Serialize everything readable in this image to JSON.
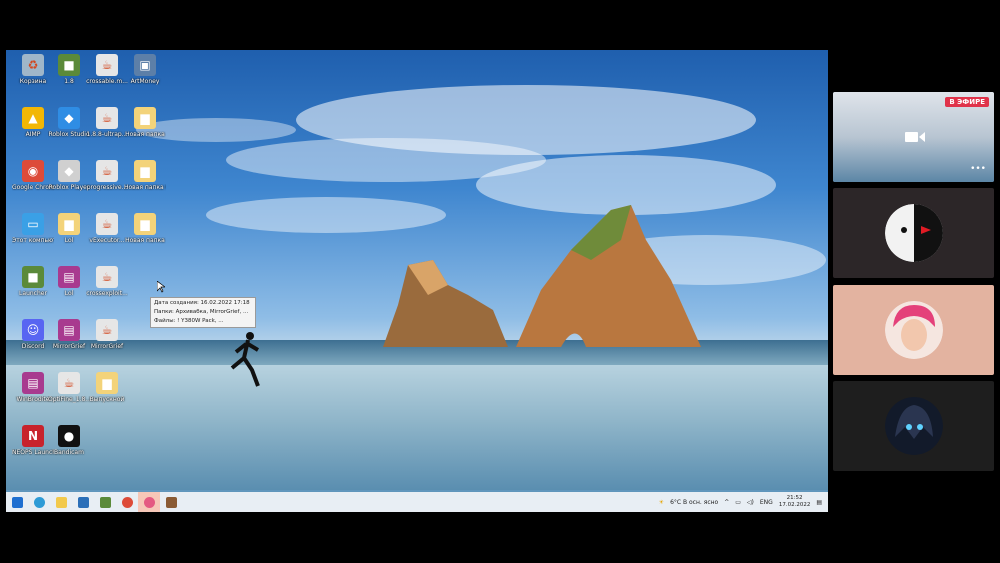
{
  "desktop": {
    "icons": [
      {
        "label": "Корзина",
        "icon": "recycle-bin-icon",
        "color": "#9fb6c9"
      },
      {
        "label": "1.8",
        "icon": "minecraft-icon",
        "color": "#5b8a3a"
      },
      {
        "label": "crossable.m...",
        "icon": "java-icon",
        "color": "#e6e6e6"
      },
      {
        "label": "ArtMoney",
        "icon": "app-icon",
        "color": "#5c7fa8"
      },
      {
        "label": "AIMP",
        "icon": "aimp-icon",
        "color": "#f2b705"
      },
      {
        "label": "Roblox Studio",
        "icon": "roblox-studio-icon",
        "color": "#2f8de4"
      },
      {
        "label": "1.8.8-ultrap...",
        "icon": "java-icon",
        "color": "#e6e6e6"
      },
      {
        "label": "Новая папка",
        "icon": "folder-icon",
        "color": "#f3d37a"
      },
      {
        "label": "Google Chrome",
        "icon": "chrome-icon",
        "color": "#dd4b39"
      },
      {
        "label": "Roblox Player",
        "icon": "roblox-icon",
        "color": "#d0d0d0"
      },
      {
        "label": "progressive...",
        "icon": "java-icon",
        "color": "#e6e6e6"
      },
      {
        "label": "Новая папка (2)",
        "icon": "folder-icon",
        "color": "#f3d37a"
      },
      {
        "label": "Этот компьютер",
        "icon": "computer-icon",
        "color": "#3aa0e6"
      },
      {
        "label": "Lol",
        "icon": "folder-icon",
        "color": "#f3d37a"
      },
      {
        "label": "vExecutor...",
        "icon": "java-icon",
        "color": "#e6e6e6"
      },
      {
        "label": "Новая папка",
        "icon": "folder-icon",
        "color": "#f3d37a"
      },
      {
        "label": "Launcher",
        "icon": "minecraft-icon",
        "color": "#5b8a3a"
      },
      {
        "label": "Lol",
        "icon": "winrar-icon",
        "color": "#a83a8f"
      },
      {
        "label": "crossexploit...",
        "icon": "java-icon",
        "color": "#e6e6e6"
      },
      {
        "label": "Discord",
        "icon": "discord-icon",
        "color": "#5865f2"
      },
      {
        "label": "MirrorGrief",
        "icon": "winrar-icon",
        "color": "#a83a8f"
      },
      {
        "label": "MirrorGrief",
        "icon": "java-icon",
        "color": "#e6e6e6"
      },
      {
        "label": "WinBrodite",
        "icon": "winrar-icon",
        "color": "#a83a8f"
      },
      {
        "label": "OptiFine_1.8...",
        "icon": "java-icon",
        "color": "#e6e6e6"
      },
      {
        "label": "Выпускной",
        "icon": "folder-icon",
        "color": "#f3d37a"
      },
      {
        "label": "NEOPS Launcher",
        "icon": "launcher-icon",
        "color": "#c8232c"
      },
      {
        "label": "Bandicam",
        "icon": "record-icon",
        "color": "#111111"
      }
    ],
    "tooltip": {
      "line1": "Дата создания: 16.02.2022 17:18",
      "line2": "Папки: Архивабка, MirrorGrief, ...",
      "line3": "Файлы: !         Y380W Pack, ..."
    }
  },
  "taskbar": {
    "apps": [
      {
        "icon": "windows-start-icon",
        "color": "#1f6fd0"
      },
      {
        "icon": "edge-icon",
        "color": "#2e9bd6"
      },
      {
        "icon": "file-explorer-icon",
        "color": "#f2c94c"
      },
      {
        "icon": "mail-icon",
        "color": "#2b6fb8"
      },
      {
        "icon": "minecraft-icon",
        "color": "#5b8a3a"
      },
      {
        "icon": "chrome-icon",
        "color": "#dd4b39"
      },
      {
        "icon": "active-app-icon",
        "color": "#e45a82"
      },
      {
        "icon": "game-icon",
        "color": "#8a5b35"
      }
    ],
    "weather": "6°C  В осн. ясно",
    "tray_chevron": "^",
    "lang": "ENG",
    "time": "21:52",
    "date": "17.02.2022"
  },
  "participants": {
    "live_badge": "В ЭФИРЕ",
    "more_label": "•••"
  }
}
